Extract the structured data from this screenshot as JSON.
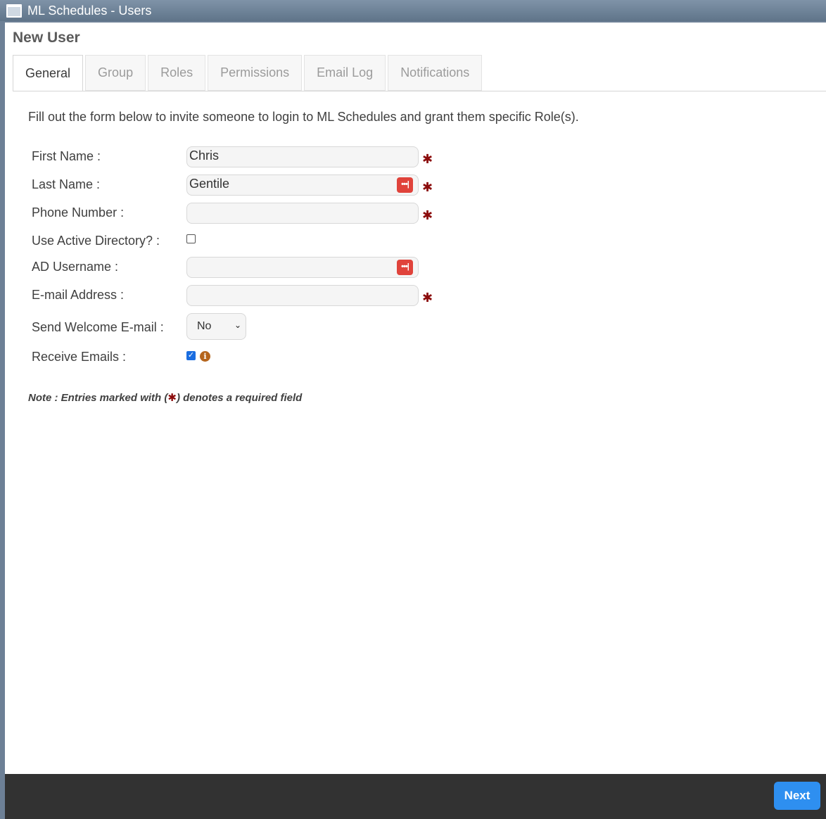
{
  "window": {
    "title": "ML Schedules - Users"
  },
  "page": {
    "title": "New User"
  },
  "tabs": [
    {
      "label": "General",
      "active": true
    },
    {
      "label": "Group",
      "active": false
    },
    {
      "label": "Roles",
      "active": false
    },
    {
      "label": "Permissions",
      "active": false
    },
    {
      "label": "Email Log",
      "active": false
    },
    {
      "label": "Notifications",
      "active": false
    }
  ],
  "intro": "Fill out the form below to invite someone to login to ML Schedules and grant them specific Role(s).",
  "form": {
    "first_name": {
      "label": "First Name :",
      "value": "Chris",
      "required": true
    },
    "last_name": {
      "label": "Last Name :",
      "value": "Gentile",
      "required": true
    },
    "phone": {
      "label": "Phone Number :",
      "value": "",
      "required": true
    },
    "use_ad": {
      "label": "Use Active Directory? :",
      "checked": false
    },
    "ad_username": {
      "label": "AD Username :",
      "value": ""
    },
    "email": {
      "label": "E-mail Address :",
      "value": "",
      "required": true
    },
    "welcome_email": {
      "label": "Send Welcome E-mail :",
      "selected": "No"
    },
    "receive_emails": {
      "label": "Receive Emails :",
      "checked": true
    }
  },
  "required_marker": "✱",
  "note": {
    "prefix": "Note : Entries marked with (",
    "star": "✱",
    "suffix": ") denotes a required field"
  },
  "footer": {
    "next_label": "Next"
  },
  "colors": {
    "accent": "#2e8ff0",
    "required": "#8b0b0b",
    "password_manager": "#e0433b",
    "footer": "#323232"
  }
}
